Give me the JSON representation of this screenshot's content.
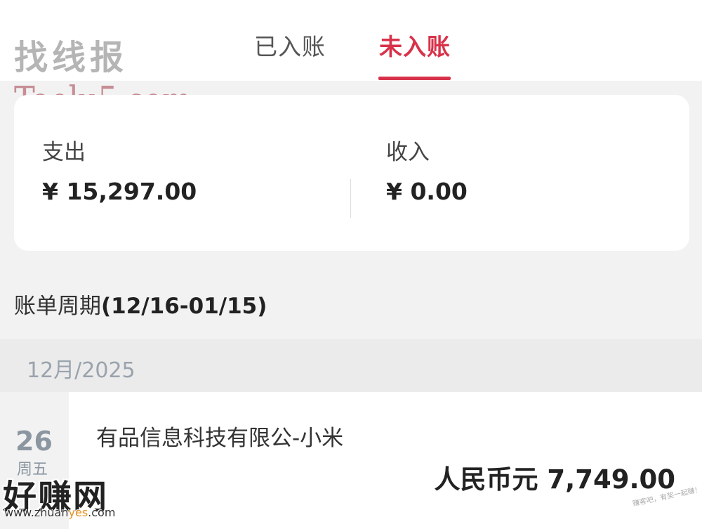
{
  "tabs": {
    "posted_label": "已入账",
    "pending_label": "未入账",
    "active": "pending"
  },
  "watermarks": {
    "top_cn": "找线报",
    "top_en": "Taolu5.com",
    "bottom_cn": "好赚网",
    "bottom_url_prefix": "www.zhuan",
    "bottom_url_highlight": "yes",
    "bottom_url_suffix": ".com",
    "corner": "赚客吧，有奖一起赚！"
  },
  "summary": {
    "expense_label": "支出",
    "expense_value": "¥ 15,297.00",
    "income_label": "收入",
    "income_value": "¥ 0.00"
  },
  "period": {
    "label": "账单周期",
    "range": "(12/16-01/15)"
  },
  "month": {
    "label": "12月/2025"
  },
  "transactions": [
    {
      "day": "26",
      "weekday": "周五",
      "merchant": "有品信息科技有限公-小米",
      "amount": "人民币元 7,749.00"
    }
  ],
  "colors": {
    "accent": "#d8324a",
    "date_text": "#8b96a1",
    "background": "#f2f2f2"
  }
}
